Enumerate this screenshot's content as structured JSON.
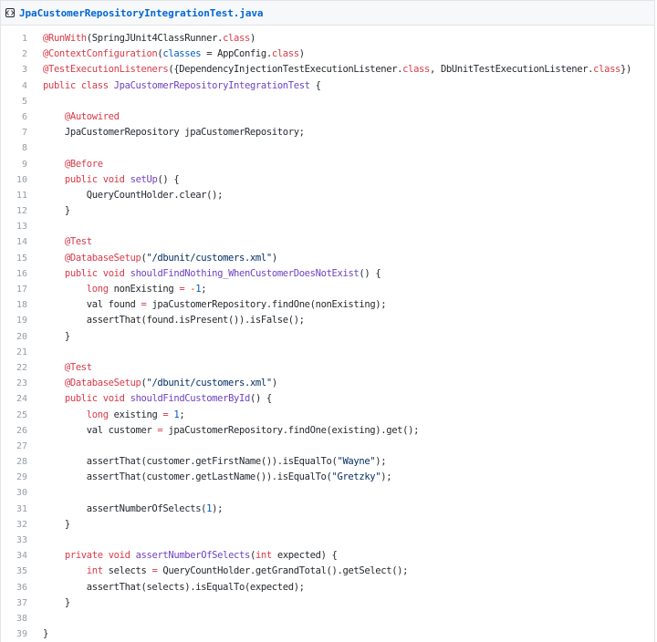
{
  "file": {
    "name": "JpaCustomerRepositoryIntegrationTest.java",
    "icon": "code-file-icon"
  },
  "colors": {
    "keyword": "#d73a49",
    "function": "#6f42c1",
    "string": "#032f62",
    "number": "#005cc5",
    "line_number": "#959da5",
    "link": "#0366d6"
  },
  "lines": [
    {
      "n": "1",
      "tokens": [
        [
          "an",
          "@RunWith"
        ],
        [
          "",
          "(SpringJUnit4ClassRunner."
        ],
        [
          "kw",
          "class"
        ],
        [
          "",
          ")"
        ]
      ]
    },
    {
      "n": "2",
      "tokens": [
        [
          "an",
          "@ContextConfiguration"
        ],
        [
          "",
          "("
        ],
        [
          "nm",
          "classes"
        ],
        [
          "",
          " = AppConfig."
        ],
        [
          "kw",
          "class"
        ],
        [
          "",
          ")"
        ]
      ]
    },
    {
      "n": "3",
      "tokens": [
        [
          "an",
          "@TestExecutionListeners"
        ],
        [
          "",
          "({DependencyInjectionTestExecutionListener."
        ],
        [
          "kw",
          "class"
        ],
        [
          "",
          ", DbUnitTestExecutionListener."
        ],
        [
          "kw",
          "class"
        ],
        [
          "",
          "})"
        ]
      ]
    },
    {
      "n": "4",
      "tokens": [
        [
          "kw",
          "public"
        ],
        [
          "",
          " "
        ],
        [
          "kw",
          "class"
        ],
        [
          "",
          " "
        ],
        [
          "fn",
          "JpaCustomerRepositoryIntegrationTest"
        ],
        [
          "",
          " {"
        ]
      ]
    },
    {
      "n": "5",
      "tokens": []
    },
    {
      "n": "6",
      "tokens": [
        [
          "",
          "    "
        ],
        [
          "an",
          "@Autowired"
        ]
      ]
    },
    {
      "n": "7",
      "tokens": [
        [
          "",
          "    JpaCustomerRepository jpaCustomerRepository;"
        ]
      ]
    },
    {
      "n": "8",
      "tokens": []
    },
    {
      "n": "9",
      "tokens": [
        [
          "",
          "    "
        ],
        [
          "an",
          "@Before"
        ]
      ]
    },
    {
      "n": "10",
      "tokens": [
        [
          "",
          "    "
        ],
        [
          "kw",
          "public"
        ],
        [
          "",
          " "
        ],
        [
          "kw",
          "void"
        ],
        [
          "",
          " "
        ],
        [
          "fn",
          "setUp"
        ],
        [
          "",
          "() {"
        ]
      ]
    },
    {
      "n": "11",
      "tokens": [
        [
          "",
          "        QueryCountHolder.clear();"
        ]
      ]
    },
    {
      "n": "12",
      "tokens": [
        [
          "",
          "    }"
        ]
      ]
    },
    {
      "n": "13",
      "tokens": []
    },
    {
      "n": "14",
      "tokens": [
        [
          "",
          "    "
        ],
        [
          "an",
          "@Test"
        ]
      ]
    },
    {
      "n": "15",
      "tokens": [
        [
          "",
          "    "
        ],
        [
          "an",
          "@DatabaseSetup"
        ],
        [
          "",
          "("
        ],
        [
          "st",
          "\"/dbunit/customers.xml\""
        ],
        [
          "",
          ")"
        ]
      ]
    },
    {
      "n": "16",
      "tokens": [
        [
          "",
          "    "
        ],
        [
          "kw",
          "public"
        ],
        [
          "",
          " "
        ],
        [
          "kw",
          "void"
        ],
        [
          "",
          " "
        ],
        [
          "fn",
          "shouldFindNothing_WhenCustomerDoesNotExist"
        ],
        [
          "",
          "() {"
        ]
      ]
    },
    {
      "n": "17",
      "tokens": [
        [
          "",
          "        "
        ],
        [
          "kw",
          "long"
        ],
        [
          "",
          " nonExisting "
        ],
        [
          "kw",
          "="
        ],
        [
          "",
          " "
        ],
        [
          "kw",
          "-"
        ],
        [
          "nm",
          "1"
        ],
        [
          "",
          ";"
        ]
      ]
    },
    {
      "n": "18",
      "tokens": [
        [
          "",
          "        val found "
        ],
        [
          "kw",
          "="
        ],
        [
          "",
          " jpaCustomerRepository.findOne(nonExisting);"
        ]
      ]
    },
    {
      "n": "19",
      "tokens": [
        [
          "",
          "        assertThat(found.isPresent()).isFalse();"
        ]
      ]
    },
    {
      "n": "20",
      "tokens": [
        [
          "",
          "    }"
        ]
      ]
    },
    {
      "n": "21",
      "tokens": []
    },
    {
      "n": "22",
      "tokens": [
        [
          "",
          "    "
        ],
        [
          "an",
          "@Test"
        ]
      ]
    },
    {
      "n": "23",
      "tokens": [
        [
          "",
          "    "
        ],
        [
          "an",
          "@DatabaseSetup"
        ],
        [
          "",
          "("
        ],
        [
          "st",
          "\"/dbunit/customers.xml\""
        ],
        [
          "",
          ")"
        ]
      ]
    },
    {
      "n": "24",
      "tokens": [
        [
          "",
          "    "
        ],
        [
          "kw",
          "public"
        ],
        [
          "",
          " "
        ],
        [
          "kw",
          "void"
        ],
        [
          "",
          " "
        ],
        [
          "fn",
          "shouldFindCustomerById"
        ],
        [
          "",
          "() {"
        ]
      ]
    },
    {
      "n": "25",
      "tokens": [
        [
          "",
          "        "
        ],
        [
          "kw",
          "long"
        ],
        [
          "",
          " existing "
        ],
        [
          "kw",
          "="
        ],
        [
          "",
          " "
        ],
        [
          "nm",
          "1"
        ],
        [
          "",
          ";"
        ]
      ]
    },
    {
      "n": "26",
      "tokens": [
        [
          "",
          "        val customer "
        ],
        [
          "kw",
          "="
        ],
        [
          "",
          " jpaCustomerRepository.findOne(existing).get();"
        ]
      ]
    },
    {
      "n": "27",
      "tokens": []
    },
    {
      "n": "28",
      "tokens": [
        [
          "",
          "        assertThat(customer.getFirstName()).isEqualTo("
        ],
        [
          "st",
          "\"Wayne\""
        ],
        [
          "",
          ");"
        ]
      ]
    },
    {
      "n": "29",
      "tokens": [
        [
          "",
          "        assertThat(customer.getLastName()).isEqualTo("
        ],
        [
          "st",
          "\"Gretzky\""
        ],
        [
          "",
          ");"
        ]
      ]
    },
    {
      "n": "30",
      "tokens": []
    },
    {
      "n": "31",
      "tokens": [
        [
          "",
          "        assertNumberOfSelects("
        ],
        [
          "nm",
          "1"
        ],
        [
          "",
          ");"
        ]
      ]
    },
    {
      "n": "32",
      "tokens": [
        [
          "",
          "    }"
        ]
      ]
    },
    {
      "n": "33",
      "tokens": []
    },
    {
      "n": "34",
      "tokens": [
        [
          "",
          "    "
        ],
        [
          "kw",
          "private"
        ],
        [
          "",
          " "
        ],
        [
          "kw",
          "void"
        ],
        [
          "",
          " "
        ],
        [
          "fn",
          "assertNumberOfSelects"
        ],
        [
          "",
          "("
        ],
        [
          "kw",
          "int"
        ],
        [
          "",
          " expected) {"
        ]
      ]
    },
    {
      "n": "35",
      "tokens": [
        [
          "",
          "        "
        ],
        [
          "kw",
          "int"
        ],
        [
          "",
          " selects "
        ],
        [
          "kw",
          "="
        ],
        [
          "",
          " QueryCountHolder.getGrandTotal().getSelect();"
        ]
      ]
    },
    {
      "n": "36",
      "tokens": [
        [
          "",
          "        assertThat(selects).isEqualTo(expected);"
        ]
      ]
    },
    {
      "n": "37",
      "tokens": [
        [
          "",
          "    }"
        ]
      ]
    },
    {
      "n": "38",
      "tokens": []
    },
    {
      "n": "39",
      "tokens": [
        [
          "",
          "}"
        ]
      ]
    }
  ]
}
